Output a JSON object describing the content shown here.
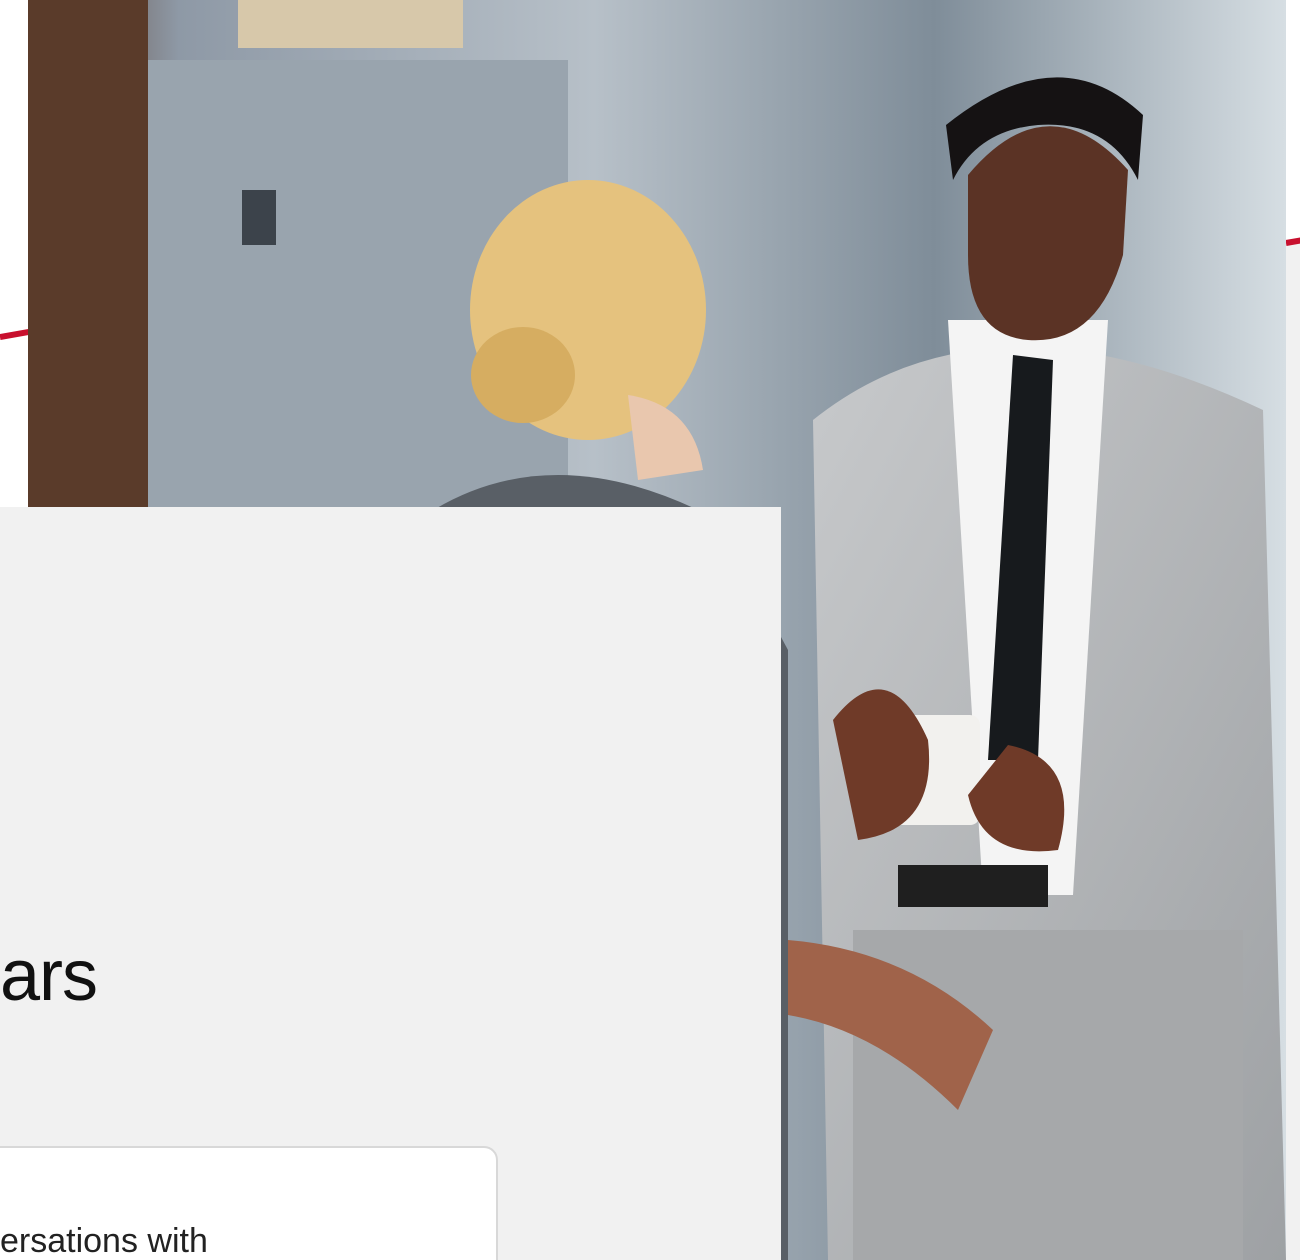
{
  "hero": {
    "image_alt_icon": "photo-two-professionals-talking-icon"
  },
  "content": {
    "headline_fragment": "ars",
    "body_fragment": "ersations with"
  },
  "colors": {
    "accent": "#c8102e",
    "card_background": "#f1f1f1",
    "text": "#111111",
    "border": "#d8d8d8"
  }
}
